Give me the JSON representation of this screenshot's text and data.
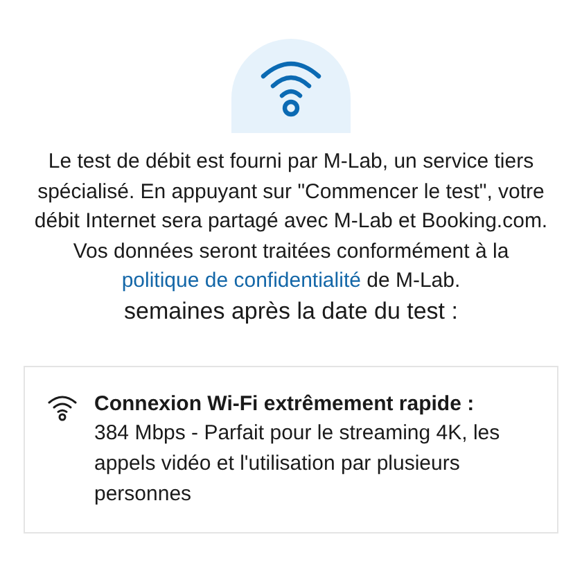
{
  "notice": {
    "text_before": "Le test de débit est fourni par M-Lab, un service tiers spécialisé. En appuyant sur \"Commencer le test\", votre débit Internet sera partagé avec M-Lab et Booking.com. Vos données seront traitées conformément à la",
    "link": "politique de confidentialité",
    "text_after": "de M-Lab."
  },
  "subtitle": "semaines après la date du test :",
  "result_card": {
    "title": "Connexion Wi-Fi extrêmement rapide :",
    "description": "384 Mbps - Parfait pour le streaming 4K, les appels vidéo et l'utilisation par plusieurs personnes"
  }
}
